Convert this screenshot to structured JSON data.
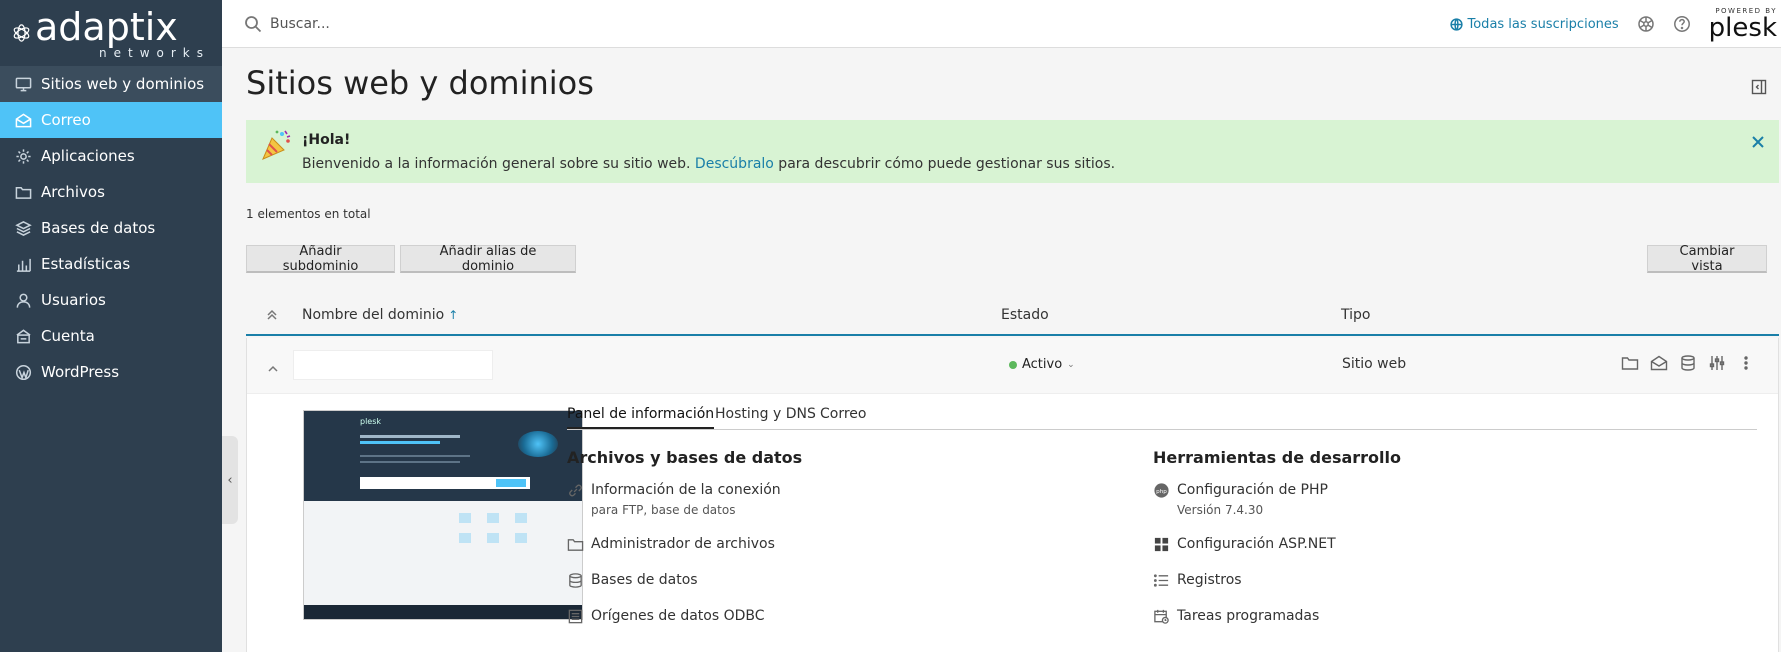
{
  "brand": {
    "name": "adaptix",
    "tagline": "networks",
    "powered_by": "POWERED BY",
    "plesk": "plesk"
  },
  "sidebar": {
    "items": [
      {
        "label": "Sitios web y dominios",
        "icon": "monitor-icon"
      },
      {
        "label": "Correo",
        "icon": "mail-icon"
      },
      {
        "label": "Aplicaciones",
        "icon": "gear-icon"
      },
      {
        "label": "Archivos",
        "icon": "folder-icon"
      },
      {
        "label": "Bases de datos",
        "icon": "database-icon"
      },
      {
        "label": "Estadísticas",
        "icon": "bar-chart-icon"
      },
      {
        "label": "Usuarios",
        "icon": "user-icon"
      },
      {
        "label": "Cuenta",
        "icon": "account-icon"
      },
      {
        "label": "WordPress",
        "icon": "wordpress-icon"
      }
    ]
  },
  "topbar": {
    "search_placeholder": "Buscar...",
    "subscriptions_label": "Todas las suscripciones"
  },
  "page": {
    "title": "Sitios web y dominios"
  },
  "banner": {
    "greeting": "¡Hola!",
    "message_before": "Bienvenido a la información general sobre su sitio web. ",
    "link": "Descúbralo",
    "message_after": " para descubrir cómo puede gestionar sus sitios."
  },
  "list": {
    "total": "1 elementos en total",
    "add_subdomain": "Añadir subdominio",
    "add_alias": "Añadir alias de dominio",
    "change_view": "Cambiar vista",
    "columns": {
      "name": "Nombre del dominio",
      "name_sort": "↑",
      "state": "Estado",
      "type": "Tipo"
    },
    "row": {
      "state": "Activo",
      "type": "Sitio web"
    }
  },
  "detail": {
    "thumb_logo": "plesk",
    "tabs": [
      "Panel de información",
      "Hosting y DNS",
      "Correo"
    ],
    "files_title": "Archivos y bases de datos",
    "files_items": [
      {
        "label": "Información de la conexión",
        "sub": "para FTP, base de datos"
      },
      {
        "label": "Administrador de archivos"
      },
      {
        "label": "Bases de datos"
      },
      {
        "label": "Orígenes de datos ODBC"
      }
    ],
    "dev_title": "Herramientas de desarrollo",
    "dev_items": [
      {
        "label": "Configuración de PHP",
        "sub": "Versión 7.4.30"
      },
      {
        "label": "Configuración ASP.NET"
      },
      {
        "label": "Registros"
      },
      {
        "label": "Tareas programadas"
      }
    ]
  },
  "colors": {
    "sidebar": "#2e3f4f",
    "active": "#4fc3f7",
    "link": "#1a7fa8",
    "banner": "#d8f3d3",
    "status_ok": "#5cb85c"
  }
}
